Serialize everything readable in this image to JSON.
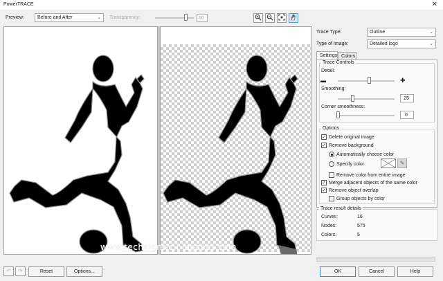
{
  "window": {
    "title": "PowerTRACE",
    "close_glyph": "✕"
  },
  "toolbar": {
    "preview_label": "Preview:",
    "preview_value": "Before and After",
    "transparency_label": "Transparency:",
    "transparency_value": "80",
    "transparency_level": 0.8,
    "zoom_in_icon": "zoom-in-icon",
    "zoom_out_icon": "zoom-out-icon",
    "fit_icon": "zoom-to-fit-icon",
    "pan_icon": "pan-hand-icon"
  },
  "watermark": "www.techsigntic.blogspot.com",
  "panel": {
    "trace_type_label": "Trace Type:",
    "trace_type_value": "Outline",
    "image_type_label": "Type of Image:",
    "image_type_value": "Detailed logo",
    "tabs": [
      "Settings",
      "Colors"
    ],
    "trace_controls": {
      "title": "Trace Controls",
      "detail_label": "Detail:",
      "detail_minus": "▬",
      "detail_plus": "✚",
      "detail_level": 0.55,
      "smoothing_label": "Smoothing:",
      "smoothing_value": "25",
      "corner_label": "Corner smoothness:",
      "corner_value": "0"
    },
    "options": {
      "title": "Options",
      "delete_original": "Delete original image",
      "remove_background": "Remove background",
      "auto_color": "Automatically choose color",
      "specify_color": "Specify color:",
      "remove_entire": "Remove color from entire image",
      "merge_adjacent": "Merge adjacent objects of the same color",
      "remove_overlap": "Remove object overlap",
      "group_by_color": "Group objects by color"
    },
    "results": {
      "title": "Trace result details",
      "rows": [
        {
          "label": "Curves:",
          "value": "16"
        },
        {
          "label": "Nodes:",
          "value": "575"
        },
        {
          "label": "Colors:",
          "value": "5"
        }
      ]
    }
  },
  "footer": {
    "undo_icon": "undo-icon",
    "redo_icon": "redo-icon",
    "reset": "Reset",
    "options": "Options...",
    "ok": "OK",
    "cancel": "Cancel",
    "help": "Help"
  },
  "colors": {
    "accent": "#3c88d8",
    "silhouette": "#000000"
  }
}
